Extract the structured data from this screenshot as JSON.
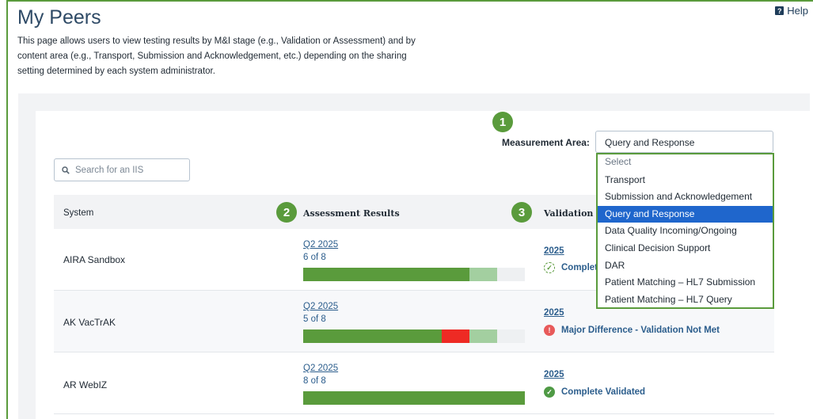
{
  "page": {
    "title": "My Peers",
    "help_label": "Help",
    "description": "This page allows users to view testing results by M&I stage (e.g., Validation or Assessment) and by content area (e.g., Transport, Submission and Acknowledgement, etc.) depending on the sharing setting determined by each system administrator."
  },
  "markers": [
    "1",
    "2",
    "3"
  ],
  "filters": {
    "measurement_area_label": "Measurement Area:",
    "measurement_area_value": "Query and Response",
    "search_placeholder": "Search for an IIS"
  },
  "dropdown": {
    "options": [
      "Select",
      "Transport",
      "Submission and Acknowledgement",
      "Query and Response",
      "Data Quality Incoming/Ongoing",
      "Clinical Decision Support",
      "DAR",
      "Patient Matching – HL7 Submission",
      "Patient Matching – HL7 Query"
    ],
    "selected_index": 3
  },
  "table": {
    "headers": {
      "system": "System",
      "assessment": "Assessment Results",
      "validation": "Validation Re"
    },
    "rows": [
      {
        "system": "AIRA Sandbox",
        "assessment_period": "Q2 2025",
        "assessment_count": "6 of 8",
        "bar": {
          "green": 0.75,
          "red": 0.0,
          "light_green": 0.125
        },
        "validation_year": "2025",
        "validation_status": "Complete",
        "status_icon": "dashed-check-icon"
      },
      {
        "system": "AK VacTrAK",
        "assessment_period": "Q2 2025",
        "assessment_count": "5 of 8",
        "bar": {
          "green": 0.625,
          "red": 0.125,
          "light_green": 0.125
        },
        "validation_year": "2025",
        "validation_status": "Major Difference - Validation Not Met",
        "status_icon": "exclamation-icon"
      },
      {
        "system": "AR WebIZ",
        "assessment_period": "Q2 2025",
        "assessment_count": "8 of 8",
        "bar": {
          "green": 1.0,
          "red": 0.0,
          "light_green": 0.0
        },
        "validation_year": "2025",
        "validation_status": "Complete Validated",
        "status_icon": "check-circle-icon"
      }
    ]
  },
  "colors": {
    "accent_green": "#5a9b3c",
    "bar_light_green": "#a3cfa0",
    "bar_red": "#ee2a24",
    "link_blue": "#2b5d8c",
    "selected_blue": "#1f66cc"
  }
}
